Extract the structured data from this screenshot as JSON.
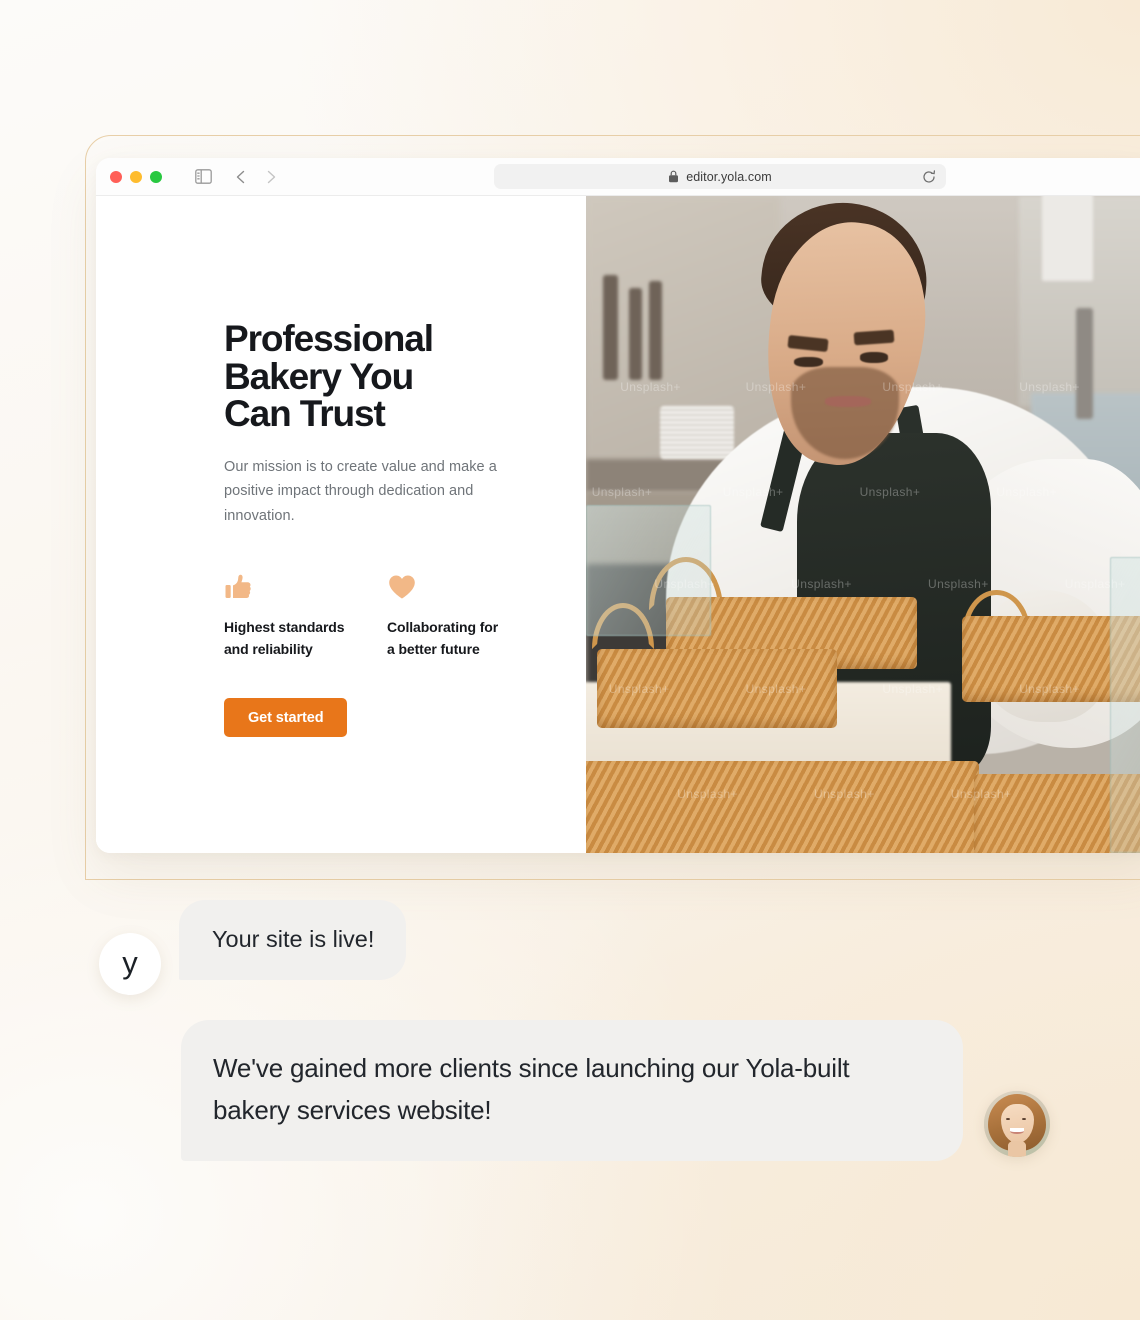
{
  "browser": {
    "window_controls": [
      "close",
      "minimize",
      "maximize"
    ],
    "sidebar_icon": "sidebar-toggle-icon",
    "back_label": "Back",
    "forward_label": "Forward",
    "shield_icon": "privacy-shield-icon",
    "lock_icon": "lock-icon",
    "url": "editor.yola.com",
    "reload_icon": "reload-icon"
  },
  "hero": {
    "heading": "Professional\nBakery You\nCan Trust",
    "subtext": "Our mission is to create value and make a\npositive impact through dedication and\ninnovation.",
    "features": [
      {
        "icon": "thumbs-up-icon",
        "label": "Highest standards\nand reliability"
      },
      {
        "icon": "heart-icon",
        "label": "Collaborating for\na better future"
      }
    ],
    "cta_label": "Get started",
    "photo_alt": "Baker in white shirt and dark apron arranging baskets of pastries",
    "photo_watermark": "Unsplash+"
  },
  "chat": {
    "brand_initial": "y",
    "message_1": "Your site is live!",
    "message_2": "We've gained more clients since launching our Yola-built bakery services website!",
    "person_avatar_alt": "Smiling woman with auburn hair"
  },
  "colors": {
    "cta_orange": "#e8761a",
    "feature_icon_peach": "#f2b887",
    "bubble_gray": "#f1f0ee",
    "heading_dark": "#16181c",
    "body_gray": "#6f7479",
    "frame_tan": "#e8cfa8",
    "traffic_red": "#ff5f57",
    "traffic_yellow": "#febc2e",
    "traffic_green": "#28c840"
  }
}
